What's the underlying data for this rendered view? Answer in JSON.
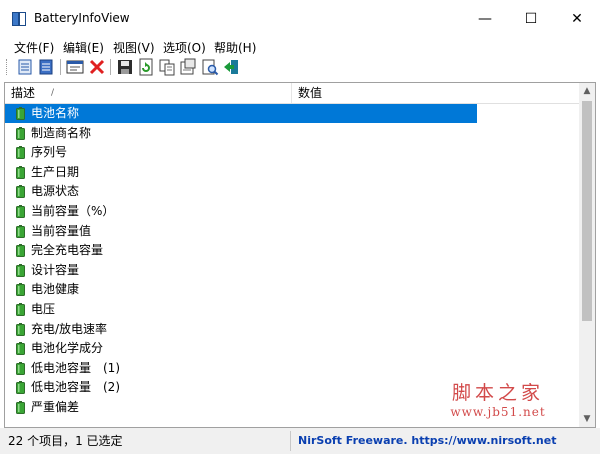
{
  "window": {
    "title": "BatteryInfoView",
    "minimize": "—",
    "maximize": "☐",
    "close": "✕"
  },
  "menu": {
    "items": [
      "文件(F)",
      "编辑(E)",
      "视图(V)",
      "选项(O)",
      "帮助(H)"
    ]
  },
  "toolbar": {
    "buttons": [
      {
        "icon": "battery-info-mode-icon"
      },
      {
        "icon": "battery-log-mode-icon"
      },
      {
        "icon": "properties-window-icon"
      },
      {
        "icon": "delete-x-icon",
        "color": "#e02020"
      },
      {
        "icon": "save-icon"
      },
      {
        "icon": "refresh-icon"
      },
      {
        "icon": "copy-icon"
      },
      {
        "icon": "html-report-icon"
      },
      {
        "icon": "find-icon"
      },
      {
        "icon": "exit-icon"
      }
    ]
  },
  "list": {
    "columns": [
      "描述",
      "数值"
    ],
    "sort_indicator": "/",
    "selected_index": 0,
    "rows": [
      "电池名称",
      "制造商名称",
      "序列号",
      "生产日期",
      "电源状态",
      "当前容量（%）",
      "当前容量值",
      "完全充电容量",
      "设计容量",
      "电池健康",
      "电压",
      "充电/放电速率",
      "电池化学成分",
      "低电池容量　(1)",
      "低电池容量　(2)",
      "严重偏差"
    ]
  },
  "scrollbar": {
    "up": "▲",
    "down": "▼"
  },
  "watermark": {
    "big": "脚本之家",
    "small": "www.jb51.net"
  },
  "status": {
    "left": "22 个项目，1 已选定",
    "right": "NirSoft Freeware. https://www.nirsoft.net"
  },
  "colors": {
    "selection": "#0078d7",
    "link": "#0a3fb0",
    "battery_green": "#3aa535",
    "watermark": "#d24a4a"
  }
}
